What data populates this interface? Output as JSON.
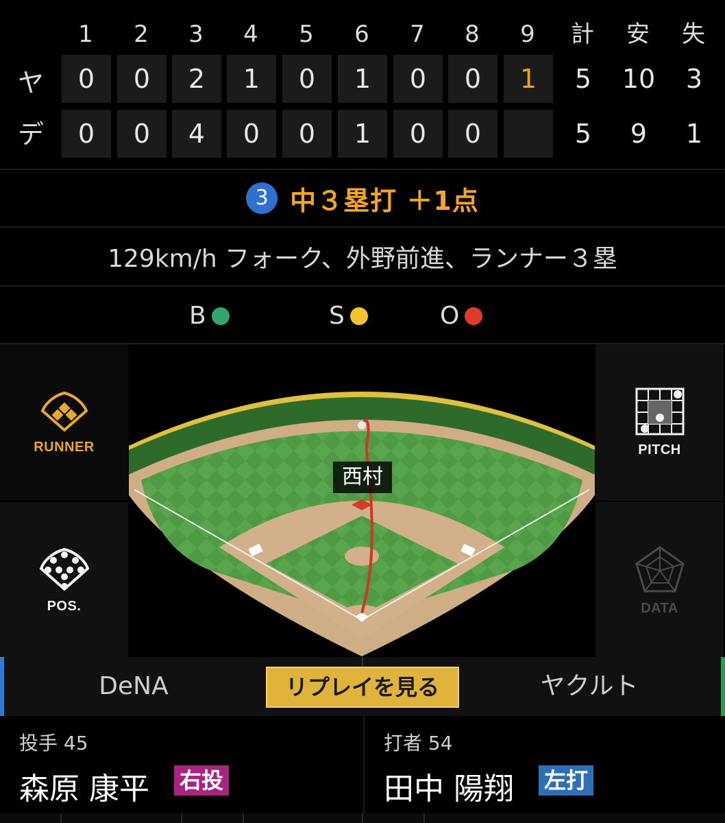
{
  "scoreboard": {
    "headers": [
      "1",
      "2",
      "3",
      "4",
      "5",
      "6",
      "7",
      "8",
      "9",
      "計",
      "安",
      "失"
    ],
    "rows": [
      {
        "team": "ヤ",
        "innings": [
          "0",
          "0",
          "2",
          "1",
          "0",
          "1",
          "0",
          "0",
          "1"
        ],
        "total": "5",
        "hits": "10",
        "errors": "3"
      },
      {
        "team": "デ",
        "innings": [
          "0",
          "0",
          "4",
          "0",
          "0",
          "1",
          "0",
          "0",
          ""
        ],
        "total": "5",
        "hits": "9",
        "errors": "1"
      }
    ],
    "highlight_color": "#f0a21f"
  },
  "play": {
    "sequence": "3",
    "result": "中３塁打 ＋1点",
    "description": "129km/h フォーク、外野前進、ランナー３塁"
  },
  "count": {
    "ball_label": "B",
    "ball_color": "#2fa86a",
    "strike_label": "S",
    "strike_color": "#f2c230",
    "out_label": "O",
    "out_color": "#e03a2a"
  },
  "side_buttons": {
    "runner": "RUNNER",
    "pitch": "PITCH",
    "pos": "POS.",
    "data": "DATA"
  },
  "field": {
    "fielder_name": "西村"
  },
  "tabs": {
    "home": "DeNA",
    "replay": "リプレイを見る",
    "away": "ヤクルト"
  },
  "pitcher": {
    "role": "投手 45",
    "name": "森原 康平",
    "hand": "右投",
    "hand_color": "#a8257f"
  },
  "batter": {
    "role": "打者 54",
    "name": "田中 陽翔",
    "hand": "左打",
    "hand_color": "#2f6fb8"
  }
}
